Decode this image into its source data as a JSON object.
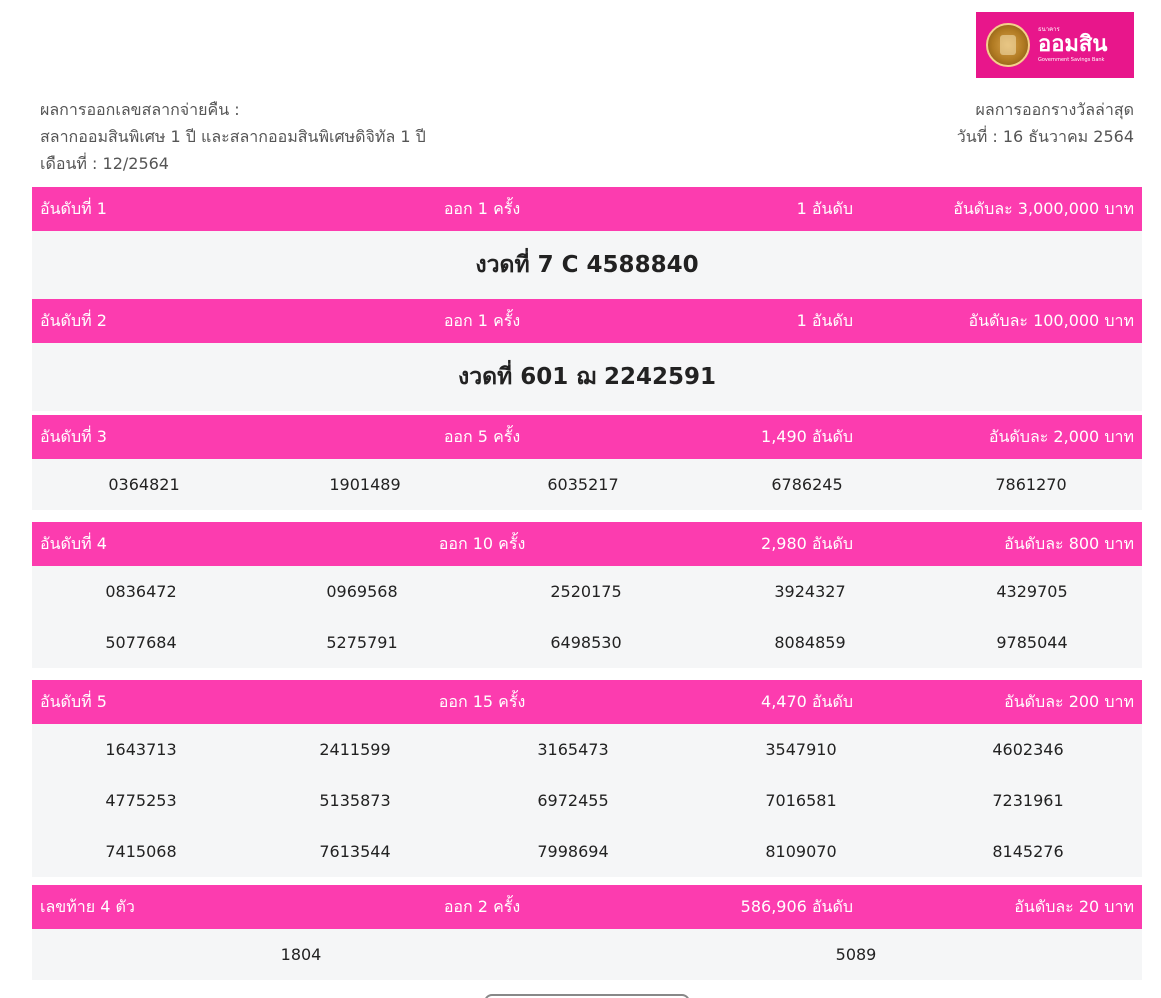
{
  "logo": {
    "brand_small": "ธนาคาร",
    "brand_name": "ออมสิน",
    "brand_en": "Government Savings Bank",
    "bg_color": "#e8168b"
  },
  "info_left": {
    "line1": "ผลการออกเลขสลากจ่ายคืน :",
    "line2": "สลากออมสินพิเศษ 1 ปี และสลากออมสินพิเศษดิจิทัล 1 ปี",
    "line3": "เดือนที่ : 12/2564"
  },
  "info_right": {
    "line1": "ผลการออกรางวัลล่าสุด",
    "line2": "วันที่ : 16 ธันวาคม 2564"
  },
  "accent_color": "#fc3caf",
  "prizes": [
    {
      "label": "อันดับที่ 1",
      "times": "ออก 1 ครั้ง",
      "count": "1 อันดับ",
      "prize": "อันดับละ 3,000,000 บาท",
      "big": "งวดที่ 7 C 4588840"
    },
    {
      "label": "อันดับที่ 2",
      "times": "ออก 1 ครั้ง",
      "count": "1 อันดับ",
      "prize": "อันดับละ 100,000 บาท",
      "big": "งวดที่ 601 ฌ 2242591"
    },
    {
      "label": "อันดับที่ 3",
      "times": "ออก 5 ครั้ง",
      "count": "1,490 อันดับ",
      "prize": "อันดับละ 2,000 บาท",
      "numbers": [
        "0364821",
        "1901489",
        "6035217",
        "6786245",
        "7861270"
      ]
    },
    {
      "label": "อันดับที่ 4",
      "times": "ออก 10 ครั้ง",
      "count": "2,980 อันดับ",
      "prize": "อันดับละ 800 บาท",
      "numbers": [
        "0836472",
        "0969568",
        "2520175",
        "3924327",
        "4329705",
        "5077684",
        "5275791",
        "6498530",
        "8084859",
        "9785044"
      ]
    },
    {
      "label": "อันดับที่ 5",
      "times": "ออก 15 ครั้ง",
      "count": "4,470 อันดับ",
      "prize": "อันดับละ 200 บาท",
      "numbers": [
        "1643713",
        "2411599",
        "3165473",
        "3547910",
        "4602346",
        "4775253",
        "5135873",
        "6972455",
        "7016581",
        "7231961",
        "7415068",
        "7613544",
        "7998694",
        "8109070",
        "8145276"
      ]
    },
    {
      "label": "เลขท้าย 4 ตัว",
      "times": "ออก 2 ครั้ง",
      "count": "586,906 อันดับ",
      "prize": "อันดับละ 20 บาท",
      "numbers": [
        "1804",
        "5089"
      ]
    }
  ]
}
